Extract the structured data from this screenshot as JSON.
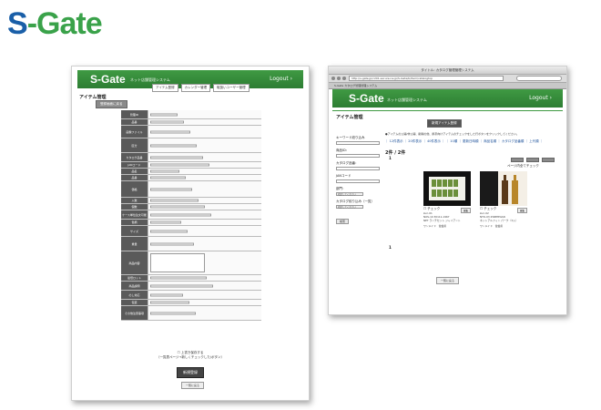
{
  "logo": {
    "s": "S",
    "rest": "-Gate"
  },
  "left": {
    "mini_logo": "S-Gate",
    "mini_sub": "ネット店舗管理システム",
    "logout": "Logout ›",
    "tabs": [
      "アイテム登録",
      "カレンダー管理",
      "取扱いユーザー管理"
    ],
    "page_title": "アイテム管理",
    "top_button": "登録画面に戻る",
    "form_rows": [
      {
        "label": "管理ID",
        "h": 10
      },
      {
        "label": "品番",
        "h": 7
      },
      {
        "label": "画像ファイル",
        "h": 14
      },
      {
        "label": "区分",
        "h": 16
      },
      {
        "label": "カタログ品番",
        "h": 10
      },
      {
        "label": "JANコード",
        "h": 7
      },
      {
        "label": "品名",
        "h": 7
      },
      {
        "label": "品番",
        "h": 7
      },
      {
        "label": "価格",
        "h": 18
      },
      {
        "label": "入数",
        "h": 7
      },
      {
        "label": "個数",
        "h": 7
      },
      {
        "label": "ケース単位注文可能",
        "h": 10
      },
      {
        "label": "色柄",
        "h": 7
      },
      {
        "label": "サイズ",
        "h": 12
      },
      {
        "label": "重量",
        "h": 16
      },
      {
        "label": "商品内容",
        "h": 26
      },
      {
        "label": "最低ロット",
        "h": 7
      },
      {
        "label": "商品説明",
        "h": 10
      },
      {
        "label": "のし対応",
        "h": 10
      },
      {
        "label": "包装",
        "h": 7
      },
      {
        "label": "その他注意事項",
        "h": 16
      }
    ],
    "confirm_check": "上書き保存する",
    "confirm_note": "（一覧表ページ→新しくチェックした/ボタン）",
    "submit": "新規登録",
    "back": "一覧に戻る"
  },
  "right": {
    "window_title": "タイトル: カタログ管理管理システム",
    "url": "http://s-gate.jp/c201.secure.ne.jp/S-Gate/b/item/catalogtop",
    "tab": "S-Gate カタログ管理管理システム",
    "mini_logo": "S-Gate",
    "mini_sub": "ネット店舗管理システム",
    "logout": "Logout ›",
    "page_title": "アイテム管理",
    "center_button": "新規アイテム登録",
    "side": {
      "keyword": "キーワード絞り込み",
      "item_id": "商品ID：",
      "catalog": "カタログ品番：",
      "jan": "JANコード",
      "category": "部門：",
      "catalog_filter": "カタログ絞り込み（一覧）",
      "select": "指定してください",
      "btn": "検索"
    },
    "note": "●アイテムの公開/非公開、削除の他、携帯向けアイテムのチェックをした行ボタンをクリックしてください。",
    "links": "｜ 12件表示 ｜ 20件表示 ｜ 40件表示 ｜ ｜ 10順 ｜ 更新日時順 ｜ 商品名順 ｜ カタログ品番順 ｜ 上代順 ｜",
    "count": "2件 / 2件",
    "page": "1",
    "page_check": "ページ内全てチェック",
    "cards": [
      {
        "check": "チェック",
        "meta": [
          "kuri-01",
          "NOS-10 30111-1967",
          "NET ランチセット ジャイアント"
        ],
        "maker": "ワンメイド　佐伯県"
      },
      {
        "check": "チェック",
        "meta": [
          "kuri-02",
          "NTO-03 2WBHE4AN",
          "ネットアルフィン パーク（3入）"
        ],
        "maker": "ワンメイド　佐伯県"
      }
    ],
    "card_btn": "編集",
    "bottom_button": "一覧に戻る",
    "bottom_page": "1"
  },
  "colors": {
    "green": "#3f9a43",
    "blue": "#1a5fa8"
  }
}
